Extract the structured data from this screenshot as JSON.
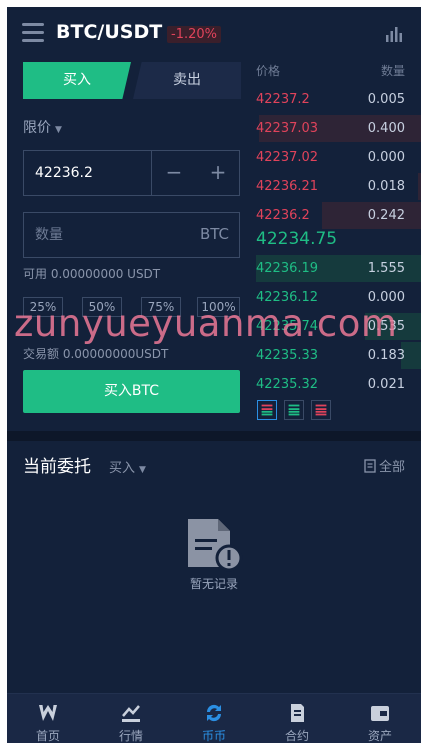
{
  "header": {
    "pair": "BTC/USDT",
    "change": "-1.20%",
    "menu_icon": "hamburger-icon",
    "kline_icon": "bar-chart-icon"
  },
  "tabs": {
    "buy": "买入",
    "sell": "卖出"
  },
  "order_type": "限价",
  "price_input": {
    "value": "42236.2"
  },
  "qty_input": {
    "placeholder": "数量",
    "unit": "BTC"
  },
  "available": "可用 0.00000000 USDT",
  "percent_buttons": [
    "25%",
    "50%",
    "75%",
    "100%"
  ],
  "turnover": "交易额 0.00000000USDT",
  "buy_button": "买入BTC",
  "order_book": {
    "price_header": "价格",
    "qty_header": "数量",
    "asks": [
      {
        "price": "42237.2",
        "qty": "0.005",
        "depth": 0.0
      },
      {
        "price": "42237.03",
        "qty": "0.400",
        "depth": 0.98
      },
      {
        "price": "42237.02",
        "qty": "0.000",
        "depth": 0.0
      },
      {
        "price": "42236.21",
        "qty": "0.018",
        "depth": 0.02
      },
      {
        "price": "42236.2",
        "qty": "0.242",
        "depth": 0.6
      }
    ],
    "last_price": "42234.75",
    "bids": [
      {
        "price": "42236.19",
        "qty": "1.555",
        "depth": 1.0
      },
      {
        "price": "42236.12",
        "qty": "0.000",
        "depth": 0.0
      },
      {
        "price": "42235.74",
        "qty": "0.535",
        "depth": 0.34
      },
      {
        "price": "42235.33",
        "qty": "0.183",
        "depth": 0.12
      },
      {
        "price": "42235.32",
        "qty": "0.021",
        "depth": 0.0
      }
    ],
    "view_icons": [
      "book-both-icon",
      "book-bids-icon",
      "book-asks-icon"
    ]
  },
  "entrust": {
    "title": "当前委托",
    "filter": "买入",
    "all_label": "全部",
    "empty_text": "暂无记录"
  },
  "bottom_nav": [
    {
      "label": "首页",
      "icon": "home-w-icon",
      "active": false
    },
    {
      "label": "行情",
      "icon": "market-icon",
      "active": false
    },
    {
      "label": "币币",
      "icon": "exchange-icon",
      "active": true
    },
    {
      "label": "合约",
      "icon": "contract-icon",
      "active": false
    },
    {
      "label": "资产",
      "icon": "wallet-icon",
      "active": false
    }
  ],
  "watermark": "zunyueyuanma.com",
  "colors": {
    "up": "#1fbd85",
    "down": "#e0435b",
    "background": "#13213a",
    "active_nav": "#2b8fe3"
  }
}
